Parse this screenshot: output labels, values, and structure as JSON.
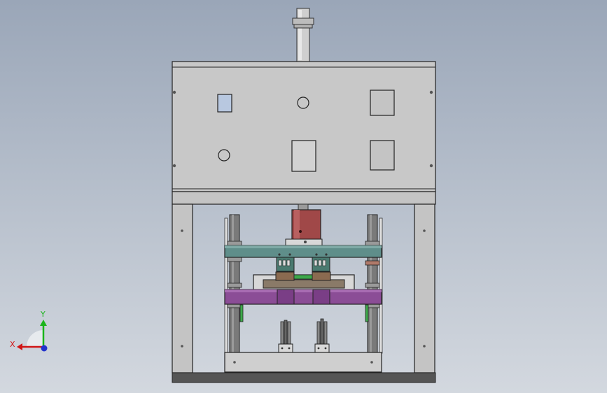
{
  "triad": {
    "x_label": "X",
    "y_label": "Y",
    "x_color": "#d11616",
    "y_color": "#1ab41a",
    "z_color": "#2233cc"
  },
  "colors": {
    "frame": "#c8c8c8",
    "outline": "#202020",
    "window_glass": "#b8c8e0",
    "pneumatic_cylinder": "#a04848",
    "guide_rod": "#7a7a7a",
    "upper_plate": "#5f8e8a",
    "lower_plate": "#8b4d96",
    "green_block": "#3da84a"
  }
}
